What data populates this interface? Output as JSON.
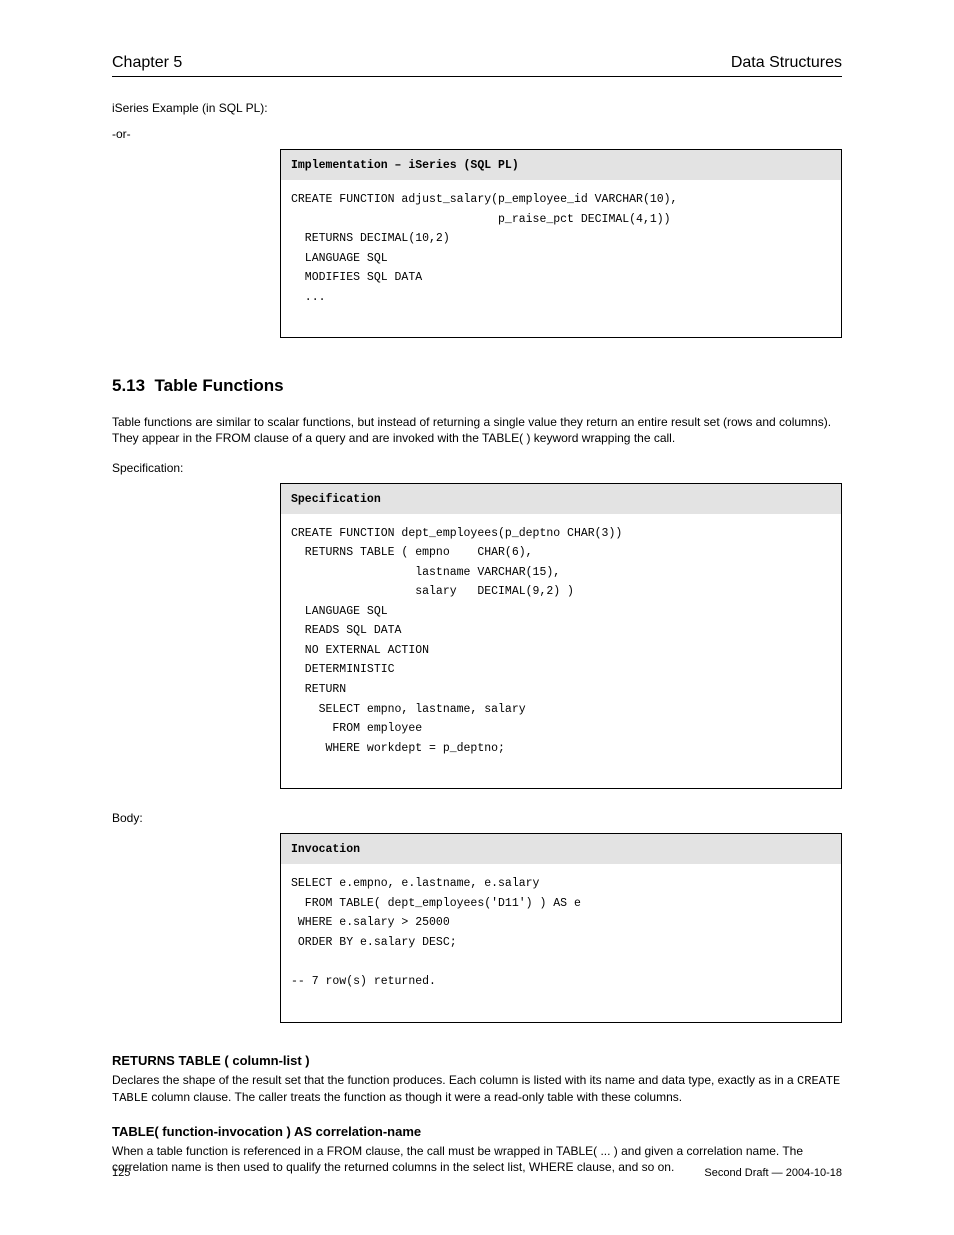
{
  "header": {
    "left": "Chapter 5",
    "right": "Data Structures"
  },
  "intro1": "iSeries Example (in SQL PL):",
  "intro2": "-or-",
  "codebox1": {
    "title": "Implementation – iSeries (SQL PL)",
    "lines": [
      "CREATE FUNCTION adjust_salary(p_employee_id VARCHAR(10),",
      "                              p_raise_pct DECIMAL(4,1))",
      "  RETURNS DECIMAL(10,2)",
      "  LANGUAGE SQL",
      "  MODIFIES SQL DATA",
      "  ..."
    ]
  },
  "section": {
    "number": "5.13",
    "title": "Table Functions",
    "desc": "Table functions are similar to scalar functions, but instead of returning a single value they return an entire result set (rows and columns). They appear in the FROM clause of a query and are invoked with the TABLE( ) keyword wrapping the call."
  },
  "label_spec": "Specification:",
  "label_body": "Body:",
  "codebox2": {
    "title": "Specification",
    "lines": [
      "CREATE FUNCTION dept_employees(p_deptno CHAR(3))",
      "  RETURNS TABLE ( empno    CHAR(6),",
      "                  lastname VARCHAR(15),",
      "                  salary   DECIMAL(9,2) )",
      "  LANGUAGE SQL",
      "  READS SQL DATA",
      "  NO EXTERNAL ACTION",
      "  DETERMINISTIC",
      "  RETURN",
      "    SELECT empno, lastname, salary",
      "      FROM employee",
      "     WHERE workdept = p_deptno;"
    ]
  },
  "codebox3": {
    "title": "Invocation",
    "lines": [
      "SELECT e.empno, e.lastname, e.salary",
      "  FROM TABLE( dept_employees('D11') ) AS e",
      " WHERE e.salary > 25000",
      " ORDER BY e.salary DESC;",
      "",
      "-- 7 row(s) returned."
    ]
  },
  "field1": {
    "name": "RETURNS TABLE ( column-list )",
    "desc_a": "Declares the shape of the result set that the function produces. Each column is listed with its name and data type, exactly as in a ",
    "desc_tt": "CREATE TABLE",
    "desc_b": " column clause. The caller treats the function as though it were a read-only table with these columns."
  },
  "field2": {
    "name": "TABLE( function-invocation ) AS correlation-name",
    "desc": "When a table function is referenced in a FROM clause, the call must be wrapped in TABLE( ... ) and given a correlation name. The correlation name is then used to qualify the returned columns in the select list, WHERE clause, and so on."
  },
  "footer": {
    "left": "125",
    "right": "Second Draft — 2004-10-18"
  }
}
